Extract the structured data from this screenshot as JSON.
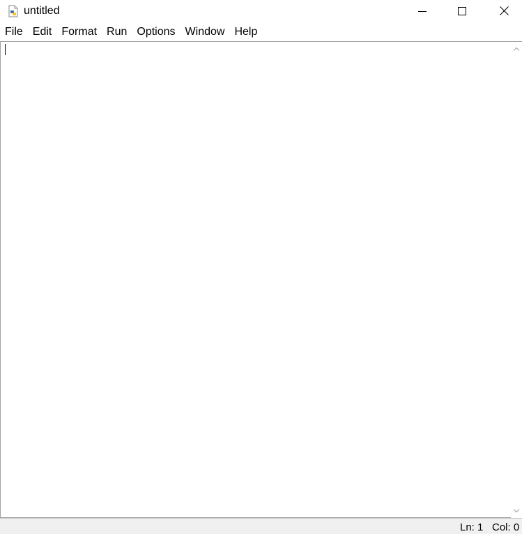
{
  "window": {
    "title": "untitled",
    "icon": "python-file-icon"
  },
  "menu": {
    "items": [
      {
        "label": "File"
      },
      {
        "label": "Edit"
      },
      {
        "label": "Format"
      },
      {
        "label": "Run"
      },
      {
        "label": "Options"
      },
      {
        "label": "Window"
      },
      {
        "label": "Help"
      }
    ]
  },
  "editor": {
    "content": ""
  },
  "status": {
    "line": "Ln: 1",
    "column": "Col: 0"
  }
}
